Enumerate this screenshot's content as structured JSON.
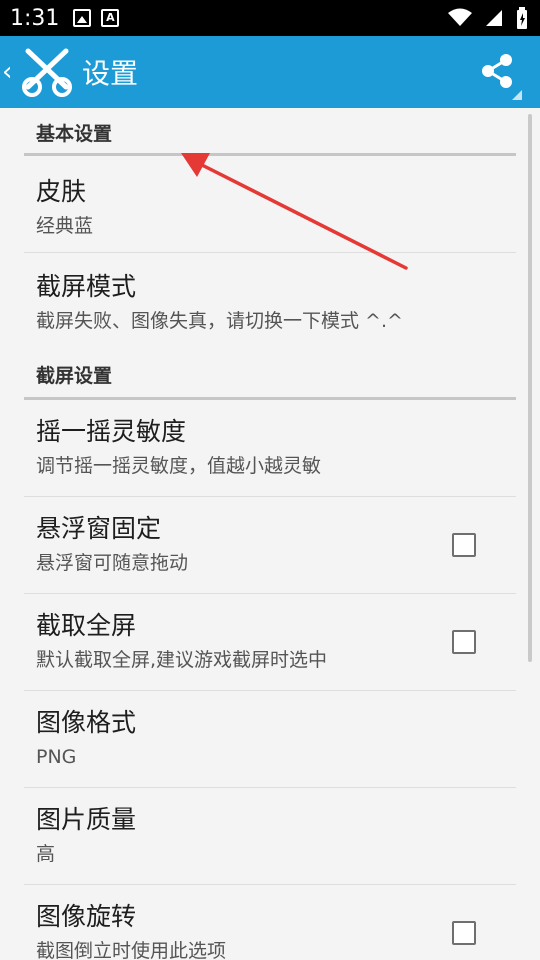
{
  "status_bar": {
    "time": "1:31",
    "icons": [
      "image-icon",
      "a-icon",
      "wifi-icon",
      "signal-icon",
      "battery-icon"
    ]
  },
  "app_bar": {
    "back_icon": "chevron-left-icon",
    "logo": "scissors-logo-icon",
    "title": "设置",
    "share_icon": "share-icon",
    "color": "#1d9bd6"
  },
  "sections": [
    {
      "header": "基本设置",
      "items": [
        {
          "title": "皮肤",
          "summary": "经典蓝",
          "checkbox": false
        },
        {
          "title": "截屏模式",
          "summary": "截屏失败、图像失真，请切换一下模式 ^.^",
          "checkbox": false
        }
      ]
    },
    {
      "header": "截屏设置",
      "items": [
        {
          "title": "摇一摇灵敏度",
          "summary": "调节摇一摇灵敏度，值越小越灵敏",
          "checkbox": false
        },
        {
          "title": "悬浮窗固定",
          "summary": "悬浮窗可随意拖动",
          "checkbox": true,
          "checked": false
        },
        {
          "title": "截取全屏",
          "summary": "默认截取全屏,建议游戏截屏时选中",
          "checkbox": true,
          "checked": false
        },
        {
          "title": "图像格式",
          "summary": "PNG",
          "checkbox": false
        },
        {
          "title": "图片质量",
          "summary": "高",
          "checkbox": false
        },
        {
          "title": "图像旋转",
          "summary": "截图倒立时使用此选项",
          "checkbox": true,
          "checked": false
        }
      ]
    }
  ],
  "annotation": {
    "type": "red-arrow",
    "color": "#e53935"
  }
}
